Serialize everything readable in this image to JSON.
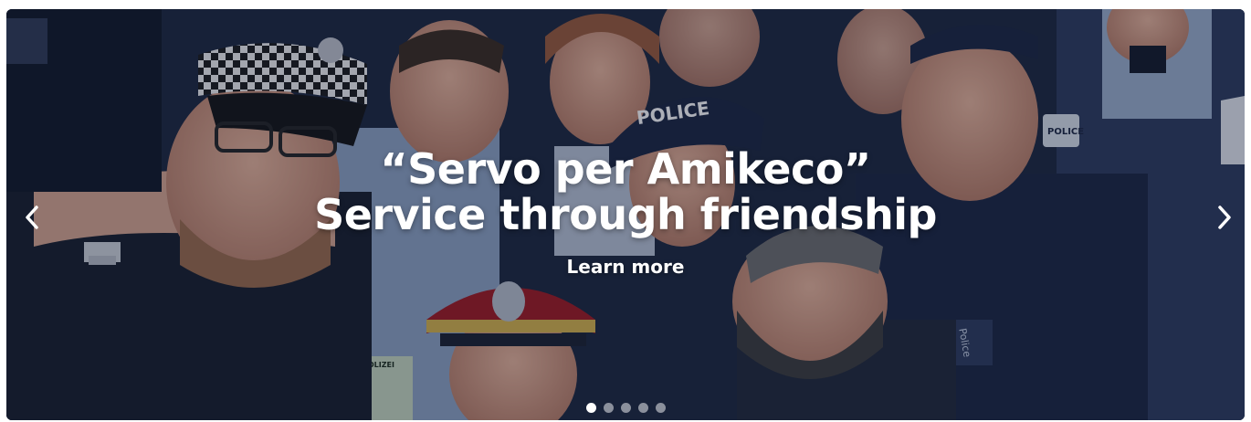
{
  "slide": {
    "title_line1": "“Servo per Amikeco”",
    "title_line2": "Service through friendship",
    "cta_label": "Learn more",
    "image_text": {
      "cap_police": "POLICE",
      "badge_polizei": "POLIZEI",
      "badge_police": "POLICE",
      "arm_badge": "POLIZEI",
      "brand": "Police"
    }
  },
  "carousel": {
    "slide_count": 5,
    "active_index": 0
  },
  "icons": {
    "prev": "chevron-left-icon",
    "next": "chevron-right-icon"
  },
  "colors": {
    "overlay": "#101a30",
    "uniform_navy": "#1a2440",
    "cap_red": "#a01820",
    "text": "#ffffff"
  }
}
